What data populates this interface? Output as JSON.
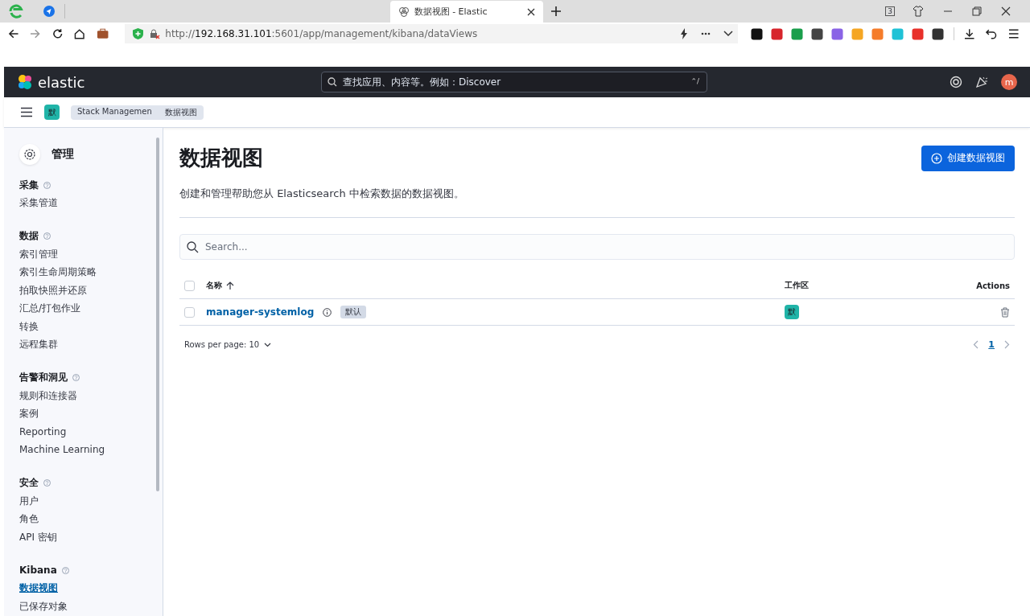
{
  "browser": {
    "tab": {
      "title": "数据视图 - Elastic",
      "selected": true
    },
    "tab_count": "3",
    "url": {
      "scheme": "http://",
      "host": "192.168.31.101",
      "path": ":5601/app/management/kibana/dataViews"
    }
  },
  "header": {
    "logo": "elastic",
    "search": {
      "placeholder": "查找应用、内容等。例如：Discover",
      "shortcut": "⌃/"
    },
    "avatar": "m"
  },
  "breadcrumbs": {
    "space": "默",
    "items": [
      "Stack Managemen",
      "数据视图"
    ]
  },
  "sidebar": {
    "title": "管理",
    "sections": [
      {
        "title": "采集",
        "items": [
          {
            "label": "采集管道",
            "selected": false
          }
        ]
      },
      {
        "title": "数据",
        "items": [
          {
            "label": "索引管理",
            "selected": false
          },
          {
            "label": "索引生命周期策略",
            "selected": false
          },
          {
            "label": "拍取快照并还原",
            "selected": false
          },
          {
            "label": "汇总/打包作业",
            "selected": false
          },
          {
            "label": "转换",
            "selected": false
          },
          {
            "label": "远程集群",
            "selected": false
          }
        ]
      },
      {
        "title": "告警和洞见",
        "items": [
          {
            "label": "规则和连接器",
            "selected": false
          },
          {
            "label": "案例",
            "selected": false
          },
          {
            "label": "Reporting",
            "selected": false
          },
          {
            "label": "Machine Learning",
            "selected": false
          }
        ]
      },
      {
        "title": "安全",
        "items": [
          {
            "label": "用户",
            "selected": false
          },
          {
            "label": "角色",
            "selected": false
          },
          {
            "label": "API 密钥",
            "selected": false
          }
        ]
      },
      {
        "title": "Kibana",
        "items": [
          {
            "label": "数据视图",
            "selected": true
          },
          {
            "label": "已保存对象",
            "selected": false
          }
        ]
      }
    ]
  },
  "page": {
    "title": "数据视图",
    "description": "创建和管理帮助您从 Elasticsearch 中检索数据的数据视图。",
    "create_button": "创建数据视图",
    "search": {
      "placeholder": "Search..."
    },
    "table": {
      "select_all": {
        "checked": false
      },
      "columns": [
        "名称",
        "工作区",
        "Actions"
      ],
      "rows": [
        {
          "checked": false,
          "name": "manager-systemlog",
          "badge": "默认",
          "space": "默"
        }
      ]
    },
    "pagination": {
      "rows_per_page": "Rows per page: 10",
      "pages": [
        {
          "label": "1",
          "selected": true
        }
      ]
    }
  }
}
